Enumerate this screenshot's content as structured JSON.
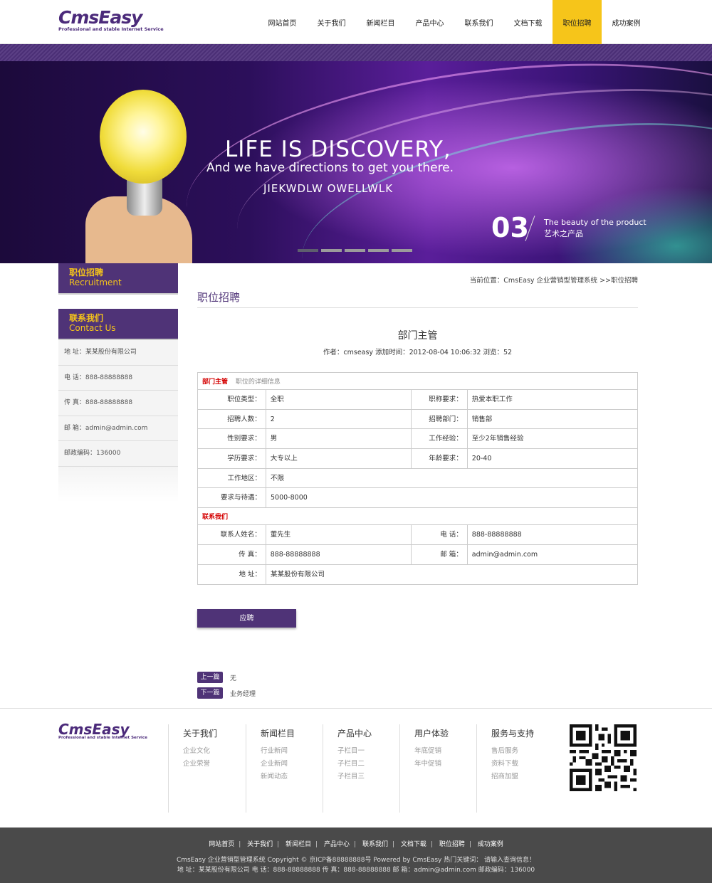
{
  "header": {
    "logo_main": "CmsEasy",
    "logo_sub": "Professional and stable Internet Service",
    "nav": [
      "网站首页",
      "关于我们",
      "新闻栏目",
      "产品中心",
      "联系我们",
      "文档下载",
      "职位招聘",
      "成功案例"
    ],
    "active_index": 6,
    "accent_color": "#f6c51a",
    "brand_color": "#4f3377"
  },
  "banner": {
    "line1": "LIFE IS DISCOVERY,",
    "line2": "And we have directions to get you there.",
    "line3": "JIEKWDLW OWELLWLK",
    "slide_number": "03",
    "caption_en": "The beauty of the product",
    "caption_cn": "艺术之产品",
    "slide_count": 5,
    "current_slide": 1
  },
  "sidebar": {
    "recruit_cn": "职位招聘",
    "recruit_en": "Recruitment",
    "contact_cn": "联系我们",
    "contact_en": "Contact Us",
    "contact_rows": [
      "地 址：某某股份有限公司",
      "电 话：888-88888888",
      "传 真：888-88888888",
      "邮 箱：admin@admin.com",
      "邮政编码：136000"
    ]
  },
  "content": {
    "breadcrumb": "当前位置：CmsEasy 企业营销型管理系统 >>职位招聘",
    "page_title": "职位招聘",
    "article_title": "部门主管",
    "article_meta": "作者：cmseasy    添加时间：2012-08-04 10:06:32    浏览：52",
    "section1_title": "部门主管",
    "section1_sub": "职位的详细信息",
    "job_rows": [
      {
        "k1": "职位类型：",
        "v1": "全职",
        "k2": "职称要求：",
        "v2": "热爱本职工作"
      },
      {
        "k1": "招聘人数：",
        "v1": "2",
        "k2": "招聘部门：",
        "v2": "销售部"
      },
      {
        "k1": "性别要求：",
        "v1": "男",
        "k2": "工作经验：",
        "v2": "至少2年销售经验"
      },
      {
        "k1": "学历要求：",
        "v1": "大专以上",
        "k2": "年龄要求：",
        "v2": "20-40"
      }
    ],
    "work_area_label": "工作地区：",
    "work_area": "不限",
    "salary_label": "要求与待遇：",
    "salary": "5000-8000",
    "section2_title": "联系我们",
    "contact_rows": [
      {
        "k1": "联系人姓名：",
        "v1": "董先生",
        "k2": "电 话：",
        "v2": "888-88888888"
      },
      {
        "k1": "传 真：",
        "v1": "888-88888888",
        "k2": "邮 箱：",
        "v2": "admin@admin.com"
      }
    ],
    "address_label": "地 址：",
    "address": "某某股份有限公司",
    "apply_button": "应聘",
    "prev_label": "上一篇",
    "prev_value": "无",
    "next_label": "下一篇",
    "next_value": "业务经理"
  },
  "footer": {
    "logo_main": "CmsEasy",
    "logo_sub": "Professional and stable Internet Service",
    "columns": [
      {
        "title": "关于我们",
        "items": [
          "企业文化",
          "企业荣誉"
        ]
      },
      {
        "title": "新闻栏目",
        "items": [
          "行业新闻",
          "企业新闻",
          "新闻动态"
        ]
      },
      {
        "title": "产品中心",
        "items": [
          "子栏目一",
          "子栏目二",
          "子栏目三"
        ]
      },
      {
        "title": "用户体验",
        "items": [
          "年底促销",
          "年中促销"
        ]
      },
      {
        "title": "服务与支持",
        "items": [
          "售后服务",
          "资料下载",
          "招商加盟"
        ]
      }
    ],
    "bottom_nav": [
      "网站首页",
      "关于我们",
      "新闻栏目",
      "产品中心",
      "联系我们",
      "文档下载",
      "职位招聘",
      "成功案例"
    ],
    "copyright": "CmsEasy 企业营销型管理系统  Copyright ©  京ICP备88888888号  Powered by CmsEasy  热门关键词： 请输入查询信息！",
    "contact_line": "地 址：某某股份有限公司   电 话：888-88888888   传 真：888-88888888   邮 箱：admin@admin.com   邮政编码：136000"
  }
}
